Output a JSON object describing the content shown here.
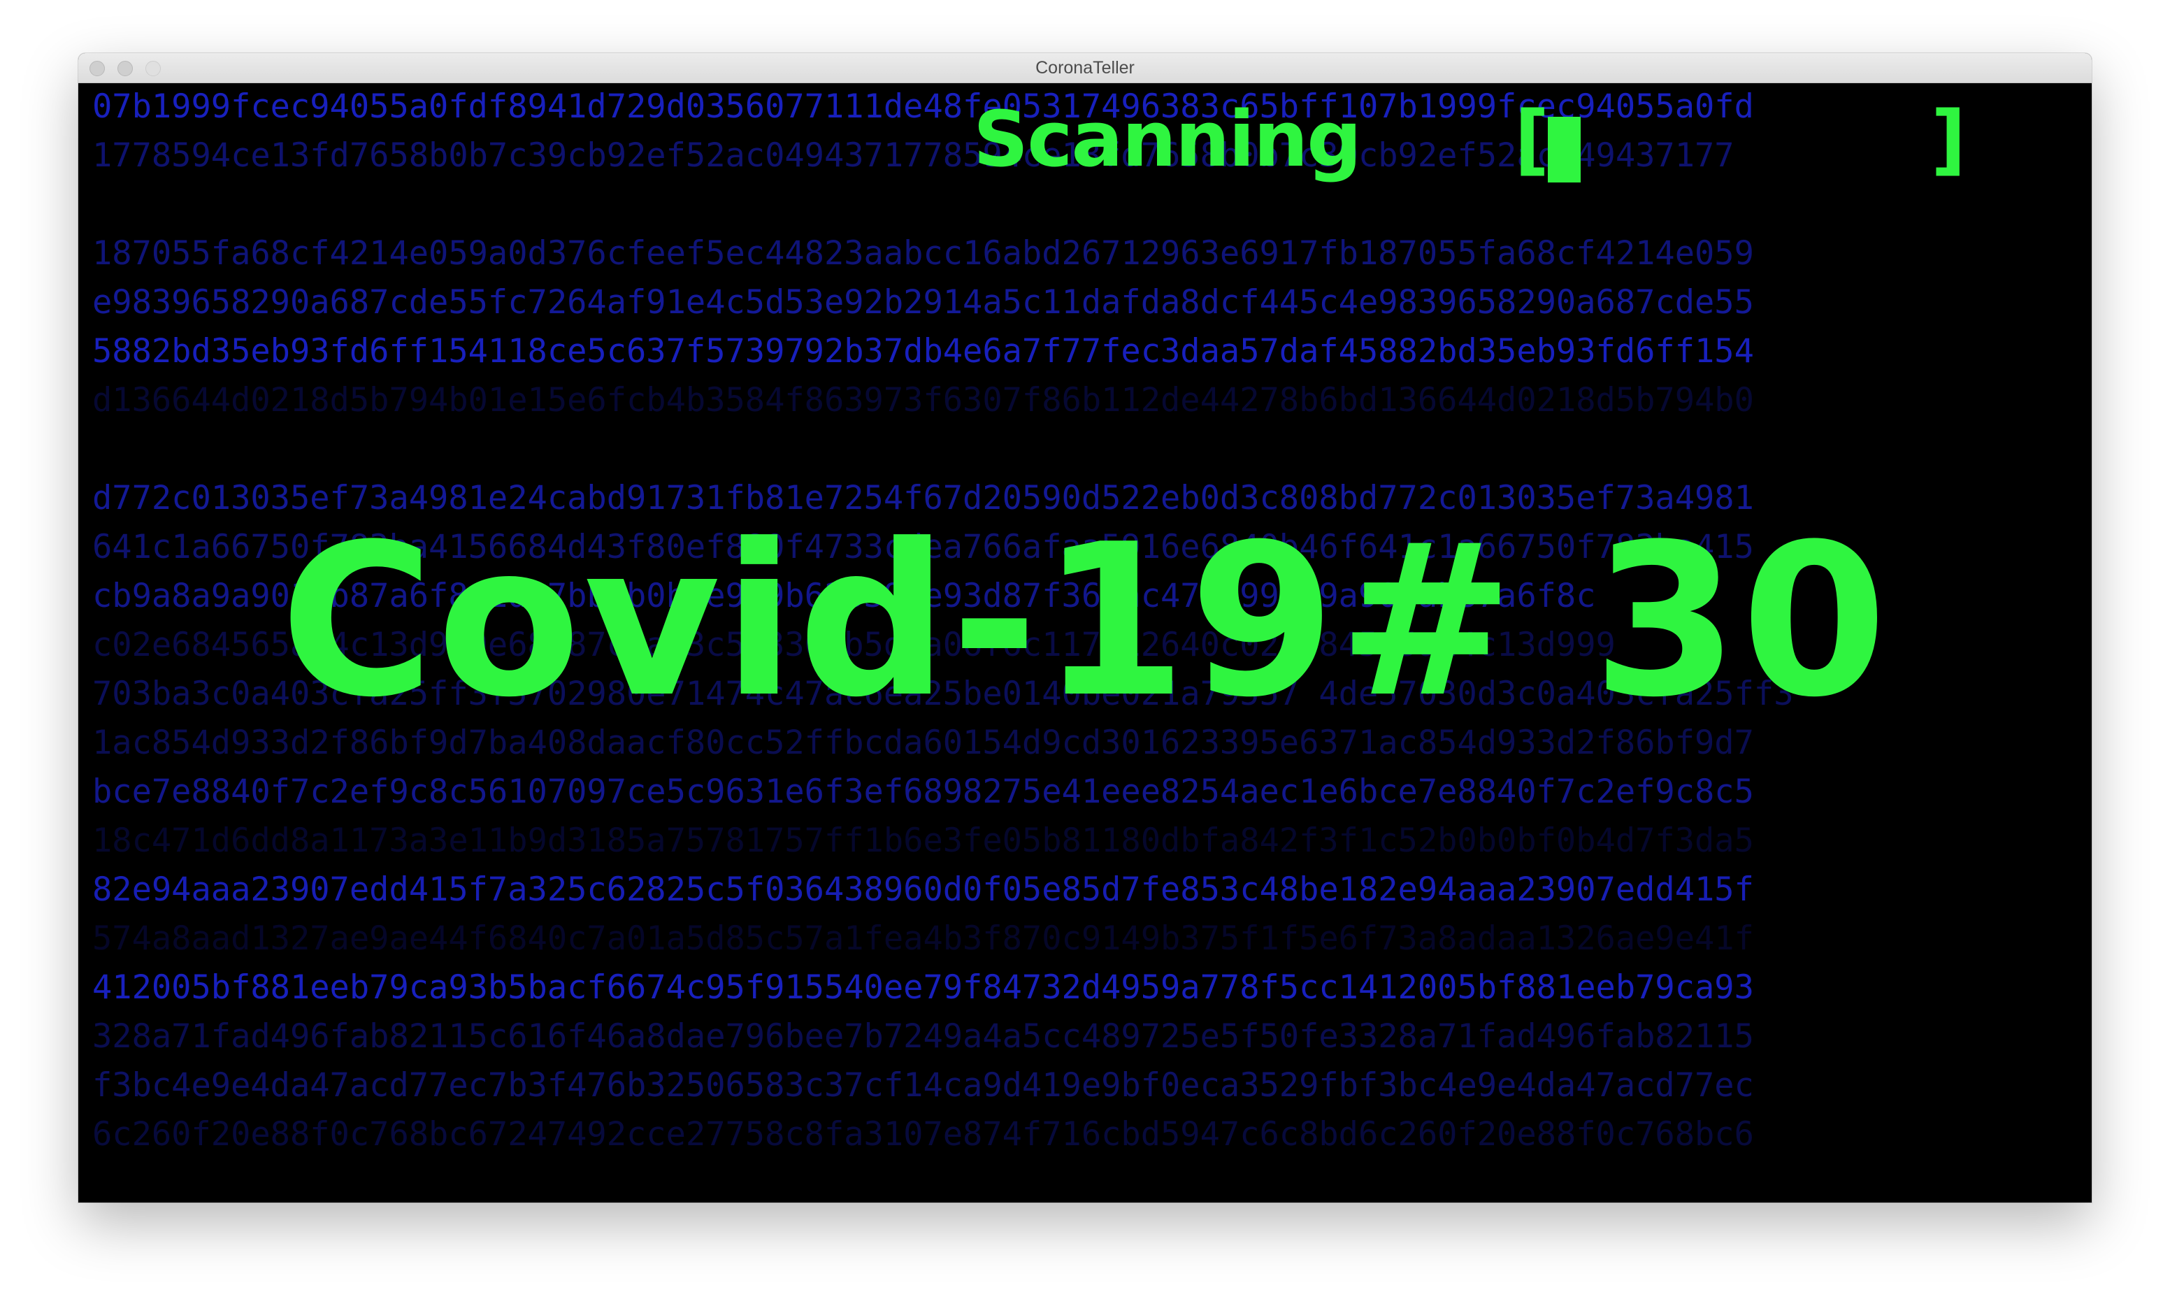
{
  "window": {
    "title": "CoronaTeller"
  },
  "scanner": {
    "label": "Scanning",
    "bracket_open": "[",
    "bracket_close": "]",
    "progress": 0.09
  },
  "headline": "Covid-19# 30",
  "hex_lines": [
    {
      "text": "07b1999fcec94055a0fdf8941d729d0356077111de48fe05317496383c65bff107b1999fcec94055a0fd",
      "alpha": 0.95
    },
    {
      "text": "1778594ce13fd7658b0b7c39cb92ef52ac0494371778594ce13fd7658b0b7c39cb92ef52ac049437177",
      "alpha": 0.55
    },
    {
      "text": "",
      "alpha": 0
    },
    {
      "text": "187055fa68cf4214e059a0d376cfeef5ec44823aabcc16abd26712963e6917fb187055fa68cf4214e059",
      "alpha": 0.6
    },
    {
      "text": "e9839658290a687cde55fc7264af91e4c5d53e92b2914a5c11dafda8dcf445c4e9839658290a687cde55",
      "alpha": 0.75
    },
    {
      "text": "5882bd35eb93fd6ff154118ce5c637f5739792b37db4e6a7f77fec3daa57daf45882bd35eb93fd6ff154",
      "alpha": 0.95
    },
    {
      "text": "d136644d0218d5b794b01e15e6fcb4b3584f863973f6307f86b112de44278b6bd136644d0218d5b794b0",
      "alpha": 0.25
    },
    {
      "text": "",
      "alpha": 0
    },
    {
      "text": "d772c013035ef73a4981e24cabd91731fb81e7254f67d20590d522eb0d3c808bd772c013035ef73a4981",
      "alpha": 0.75
    },
    {
      "text": "641c1a66750f783ba4156684d43f80ef880f4733cdea766afaa5916e6840b46f641c1a66750f783ba415",
      "alpha": 0.55
    },
    {
      "text": "cb9a8a9a901ab87a6f8c1d97bb7b0b8e919b626394e93d87f361ac476d998a9a901ab87a6f8c",
      "alpha": 0.7
    },
    {
      "text": "c02e684565a14c13d999e68f87c5a03c5b3368b5d5a06f6c117612640c02e684565a14c13d999",
      "alpha": 0.35
    },
    {
      "text": "703ba3c0a403cfa25ff3f5702980e71474c47ac6ea25be0140be021a79557 4de57030d3c0a403cfa25ff3",
      "alpha": 0.45
    },
    {
      "text": "1ac854d933d2f86bf9d7ba408daacf80cc52ffbcda60154d9cd301623395e6371ac854d933d2f86bf9d7",
      "alpha": 0.4
    },
    {
      "text": "bce7e8840f7c2ef9c8c56107097ce5c9631e6f3ef6898275e41eee8254aec1e6bce7e8840f7c2ef9c8c5",
      "alpha": 0.7
    },
    {
      "text": "18c471d6dd8a1173a3e11b9d3185a75781757ff1b6e3fe05b81180dbfa842f3f1c52b0b0bf0b4d7f3da5",
      "alpha": 0.22
    },
    {
      "text": "82e94aaa23907edd415f7a325c62825c5f036438960d0f05e85d7fe853c48be182e94aaa23907edd415f",
      "alpha": 0.9
    },
    {
      "text": "574a8aad1327ae9ae44f6840c7a01a5d85c57a1fea4b3f870c9149b375f1f5e6f73a8adaa1326ae9e41f",
      "alpha": 0.2
    },
    {
      "text": "412005bf881eeb79ca93b5bacf6674c95f915540ee79f84732d4959a778f5cc1412005bf881eeb79ca93",
      "alpha": 0.95
    },
    {
      "text": "328a71fad496fab82115c616f46a8dae796bee7b7249a4a5cc489725e5f50fe3328a71fad496fab82115",
      "alpha": 0.4
    },
    {
      "text": "f3bc4e9e4da47acd77ec7b3f476b32506583c37cf14ca9d419e9bf0eca3529fbf3bc4e9e4da47acd77ec",
      "alpha": 0.5
    },
    {
      "text": "6c260f20e88f0c768bc67247492cce27758c8fa3107e874f716cbd5947c6c8bd6c260f20e88f0c768bc6",
      "alpha": 0.3
    }
  ]
}
